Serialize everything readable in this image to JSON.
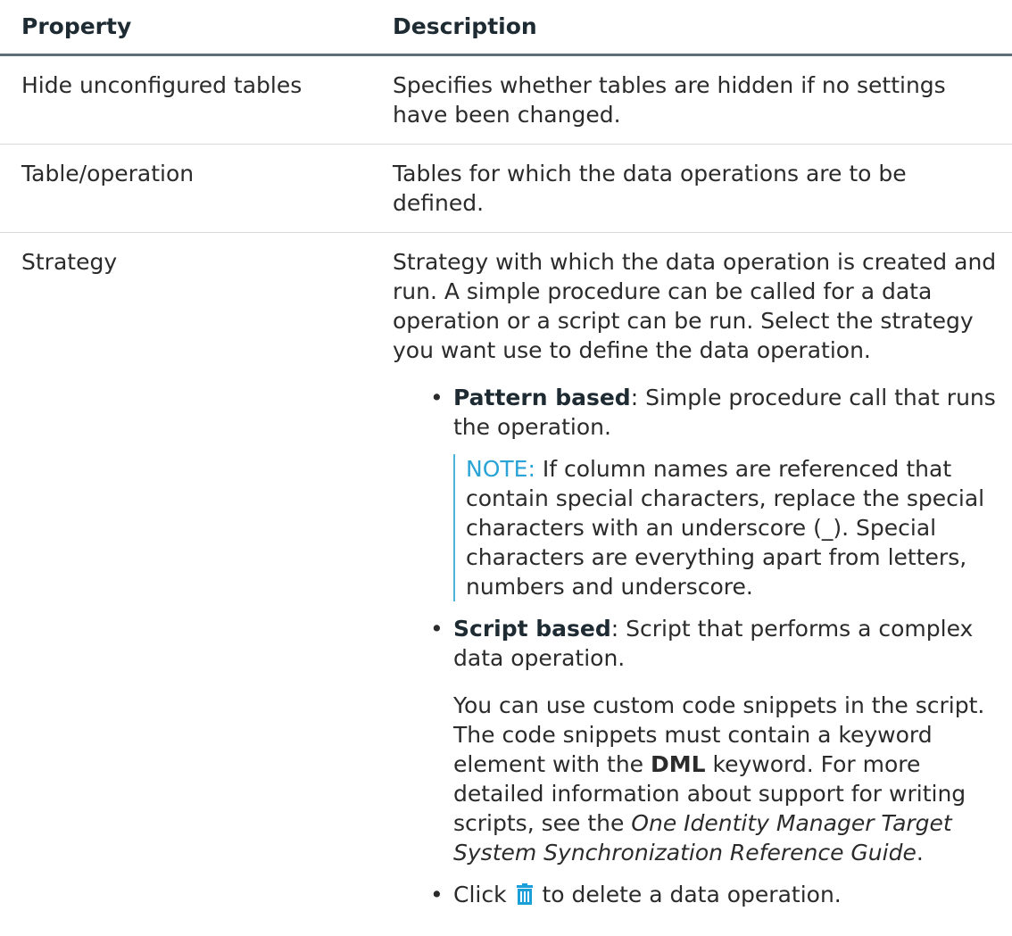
{
  "table": {
    "header": {
      "property": "Property",
      "description": "Description"
    },
    "rows": [
      {
        "property": "Hide unconfigured tables",
        "description": "Specifies whether tables are hidden if no settings have been changed."
      },
      {
        "property": "Table/operation",
        "description": "Tables for which the data operations are to be defined."
      },
      {
        "property": "Strategy",
        "description": "Strategy with which the data operation is created and run. A simple procedure can be called for a data operation or a script can be run. Select the strategy you want use to define the data operation.",
        "bullets": {
          "pattern": {
            "term": "Pattern based",
            "text": ": Simple procedure call that runs the operation.",
            "note_label": "NOTE:",
            "note_text": " If column names are referenced that contain special characters, replace the special characters with an underscore (_). Special characters are everything apart from letters, numbers and underscore."
          },
          "script": {
            "term": "Script based",
            "text": ": Script that performs a complex data operation.",
            "para_1": "You can use custom code snippets in the script. The code snippets must contain a keyword element with the ",
            "para_keyword": "DML",
            "para_2": " keyword. For more detailed information about support for writing scripts, see the ",
            "para_guide": "One Identity Manager Target System Synchronization Reference Guide",
            "para_end": "."
          },
          "delete": {
            "text_before": "Click ",
            "icon": "trash-icon",
            "text_after": " to delete a data operation."
          }
        }
      }
    ]
  },
  "colors": {
    "note_accent": "#2aa3d6",
    "icon_blue": "#1a9fd9",
    "header_rule": "#5c6f76"
  }
}
